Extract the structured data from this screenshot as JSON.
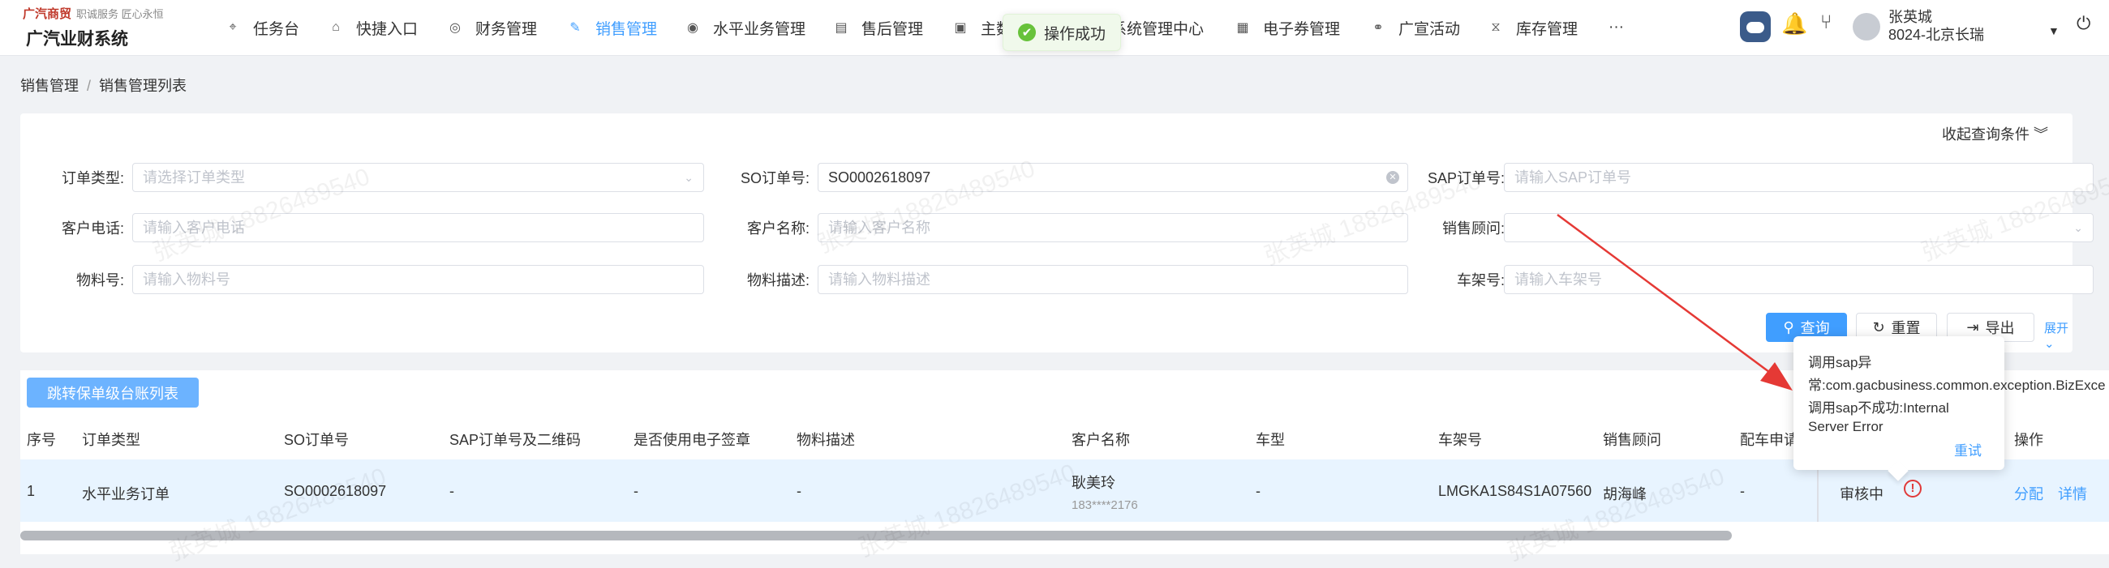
{
  "header": {
    "brand": "广汽商贸",
    "brand_slogan": "职诚服务 匠心永恒",
    "system_name": "广汽业财系统",
    "nav": [
      {
        "label": "任务台",
        "icon": "tag-icon"
      },
      {
        "label": "快捷入口",
        "icon": "home-icon"
      },
      {
        "label": "财务管理",
        "icon": "finance-icon"
      },
      {
        "label": "销售管理",
        "icon": "edit-icon",
        "active": true
      },
      {
        "label": "水平业务管理",
        "icon": "eye-icon"
      },
      {
        "label": "售后管理",
        "icon": "printer-icon"
      },
      {
        "label": "主数",
        "icon": "image-icon"
      },
      {
        "label": "系统管理中心",
        "icon": "settings-icon"
      },
      {
        "label": "电子券管理",
        "icon": "coupon-icon"
      },
      {
        "label": "广宣活动",
        "icon": "link-icon"
      },
      {
        "label": "库存管理",
        "icon": "hourglass-icon"
      },
      {
        "label": "···",
        "icon": "more-icon"
      }
    ],
    "toast": "操作成功",
    "user": {
      "name": "张英城",
      "org": "8024-北京长瑞"
    }
  },
  "breadcrumb": [
    "销售管理",
    "销售管理列表"
  ],
  "filters": {
    "collapse_label": "收起查询条件",
    "fields": [
      {
        "label": "订单类型:",
        "placeholder": "请选择订单类型",
        "value": ""
      },
      {
        "label": "SO订单号:",
        "placeholder": "",
        "value": "SO0002618097"
      },
      {
        "label": "SAP订单号:",
        "placeholder": "请输入SAP订单号",
        "value": ""
      },
      {
        "label": "客户电话:",
        "placeholder": "请输入客户电话",
        "value": ""
      },
      {
        "label": "客户名称:",
        "placeholder": "请输入客户名称",
        "value": ""
      },
      {
        "label": "销售顾问:",
        "placeholder": "",
        "value": ""
      },
      {
        "label": "物料号:",
        "placeholder": "请输入物料号",
        "value": ""
      },
      {
        "label": "物料描述:",
        "placeholder": "请输入物料描述",
        "value": ""
      },
      {
        "label": "车架号:",
        "placeholder": "请输入车架号",
        "value": ""
      }
    ],
    "search_label": "查询",
    "reset_label": "重置",
    "export_label": "导出",
    "expand_label": "展开"
  },
  "table": {
    "jump_button": "跳转保单级台账列表",
    "columns": [
      "序号",
      "订单类型",
      "SO订单号",
      "SAP订单号及二维码",
      "是否使用电子签章",
      "物料描述",
      "客户名称",
      "车型",
      "车架号",
      "销售顾问",
      "配车申请",
      "操作"
    ],
    "row": {
      "index": "1",
      "order_type": "水平业务订单",
      "so_number": "SO0002618097",
      "sap_number": "-",
      "e_signature": "-",
      "material_desc": "-",
      "customer_name": "耿美玲",
      "customer_phone": "183****2176",
      "car_model": "-",
      "vin": "LMGKA1S84S1A07560",
      "sales_advisor": "胡海峰",
      "allocation": "-",
      "status": "审核中",
      "actions": [
        "分配",
        "详情"
      ]
    }
  },
  "tooltip": {
    "lines": [
      "调用sap异",
      "常:com.gacbusiness.common.exception.BizExce",
      "调用sap不成功:Internal",
      "Server Error"
    ],
    "retry": "重试"
  },
  "watermark": "张英城 18826489540",
  "colors": {
    "primary": "#409eff",
    "success": "#67c23a",
    "error": "#e03a3a",
    "arrow": "#e53935"
  }
}
